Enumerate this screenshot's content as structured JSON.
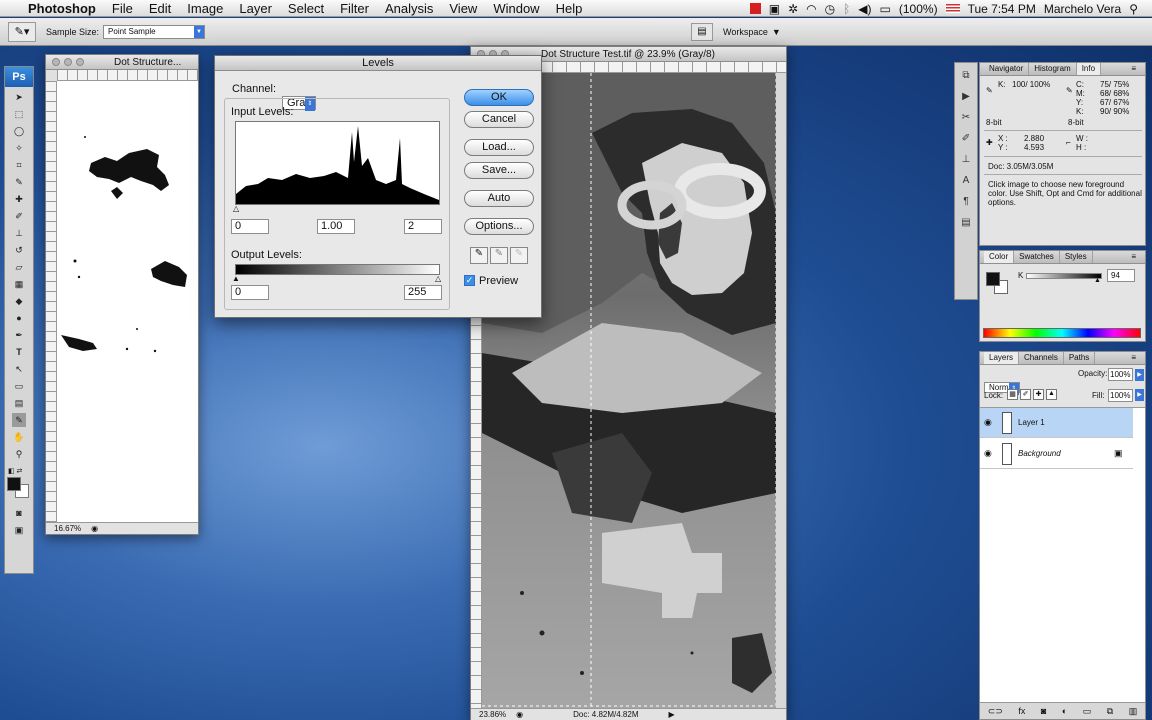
{
  "menubar": {
    "apple": "",
    "app_name": "Photoshop",
    "items": [
      "File",
      "Edit",
      "Image",
      "Layer",
      "Select",
      "Filter",
      "Analysis",
      "View",
      "Window",
      "Help"
    ],
    "battery": "(100%)",
    "clock": "Tue 7:54 PM",
    "user": "Marchelo Vera"
  },
  "options_bar": {
    "sample_size_label": "Sample Size:",
    "sample_size_value": "Point Sample",
    "workspace_label": "Workspace"
  },
  "toolbox": {
    "logo": "Ps"
  },
  "small_doc": {
    "title": "Dot Structure...",
    "zoom": "16.67%"
  },
  "main_doc": {
    "title": "Dot Structure Test.tif @ 23.9% (Gray/8)",
    "zoom": "23.86%",
    "doc_info": "Doc: 4.82M/4.82M"
  },
  "levels_dialog": {
    "title": "Levels",
    "channel_label": "Channel:",
    "channel_value": "Gray",
    "input_levels_label": "Input Levels:",
    "input_black": "0",
    "input_gamma": "1.00",
    "input_white": "2",
    "output_levels_label": "Output Levels:",
    "output_black": "0",
    "output_white": "255",
    "buttons": {
      "ok": "OK",
      "cancel": "Cancel",
      "load": "Load...",
      "save": "Save...",
      "auto": "Auto",
      "options": "Options..."
    },
    "preview_label": "Preview",
    "preview_checked": true
  },
  "info_panel": {
    "tabs": [
      "Navigator",
      "Histogram",
      "Info"
    ],
    "active_tab": "Info",
    "k_label": "K:",
    "k_values": "100/ 100%",
    "cmyk": [
      {
        "label": "C:",
        "value": "75/ 75%"
      },
      {
        "label": "M:",
        "value": "68/ 68%"
      },
      {
        "label": "Y:",
        "value": "67/ 67%"
      },
      {
        "label": "K:",
        "value": "90/ 90%"
      }
    ],
    "bit_left": "8-bit",
    "bit_right": "8-bit",
    "x_label": "X :",
    "x_value": "2.880",
    "y_label": "Y :",
    "y_value": "4.593",
    "w_label": "W :",
    "h_label": "H :",
    "doc_size": "Doc: 3.05M/3.05M",
    "hint": "Click image to choose new foreground color.  Use Shift, Opt and Cmd for additional options."
  },
  "color_panel": {
    "tabs": [
      "Color",
      "Swatches",
      "Styles"
    ],
    "channel": "K",
    "value": "94",
    "foreground": "#111111",
    "background": "#ffffff"
  },
  "layers_panel": {
    "tabs": [
      "Layers",
      "Channels",
      "Paths"
    ],
    "blend_mode": "Normal",
    "opacity_label": "Opacity:",
    "opacity_value": "100%",
    "lock_label": "Lock:",
    "fill_label": "Fill:",
    "fill_value": "100%",
    "layers": [
      {
        "name": "Layer 1",
        "selected": true,
        "locked": false
      },
      {
        "name": "Background",
        "selected": false,
        "locked": true
      }
    ]
  },
  "colors": {
    "accent": "#3c8fe8",
    "selection": "#b9d5f5"
  }
}
